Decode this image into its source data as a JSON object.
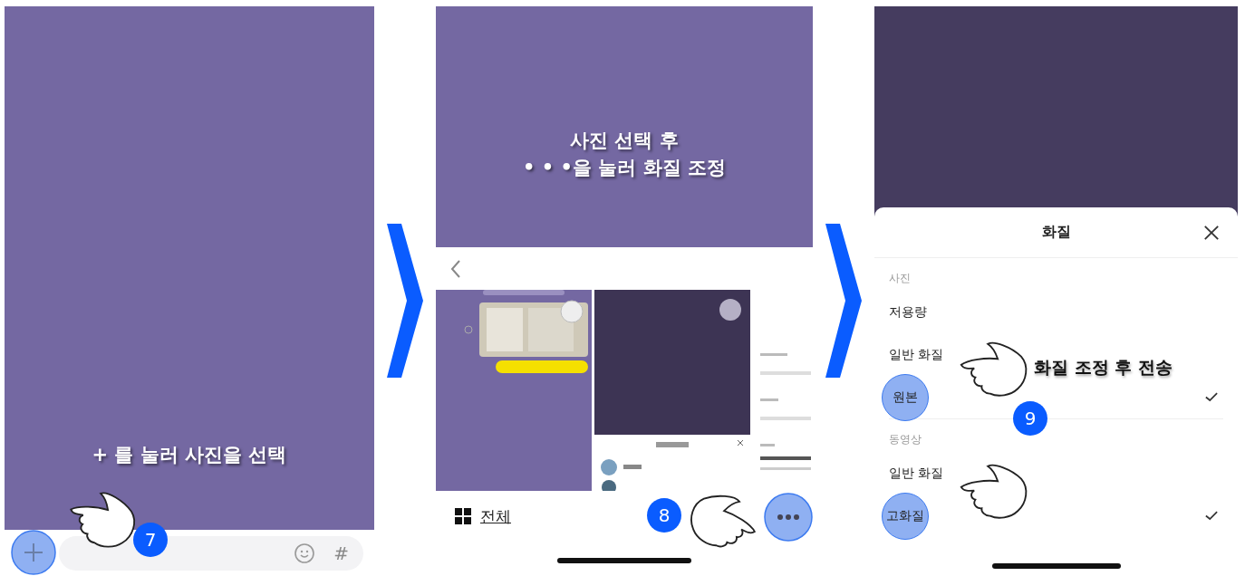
{
  "panel_1": {
    "caption": "+ 를 눌러 사진을 선택",
    "step": "7",
    "hash": "#"
  },
  "panel_2": {
    "caption_lines": [
      "사진 선택 후",
      "• • •을 눌러 화질 조정"
    ],
    "step": "8",
    "all_label": "전체"
  },
  "panel_3": {
    "sheet_title": "화질",
    "caption": "화질 조정 후 전송",
    "step": "9",
    "sections": [
      {
        "heading": "사진",
        "options": [
          {
            "label": "저용량",
            "selected": false,
            "highlighted": false
          },
          {
            "label": "일반 화질",
            "selected": false,
            "highlighted": false
          },
          {
            "label": "원본",
            "selected": true,
            "highlighted": true
          }
        ]
      },
      {
        "heading": "동영상",
        "options": [
          {
            "label": "일반 화질",
            "selected": false,
            "highlighted": false
          },
          {
            "label": "고화질",
            "selected": true,
            "highlighted": true
          }
        ]
      }
    ]
  }
}
